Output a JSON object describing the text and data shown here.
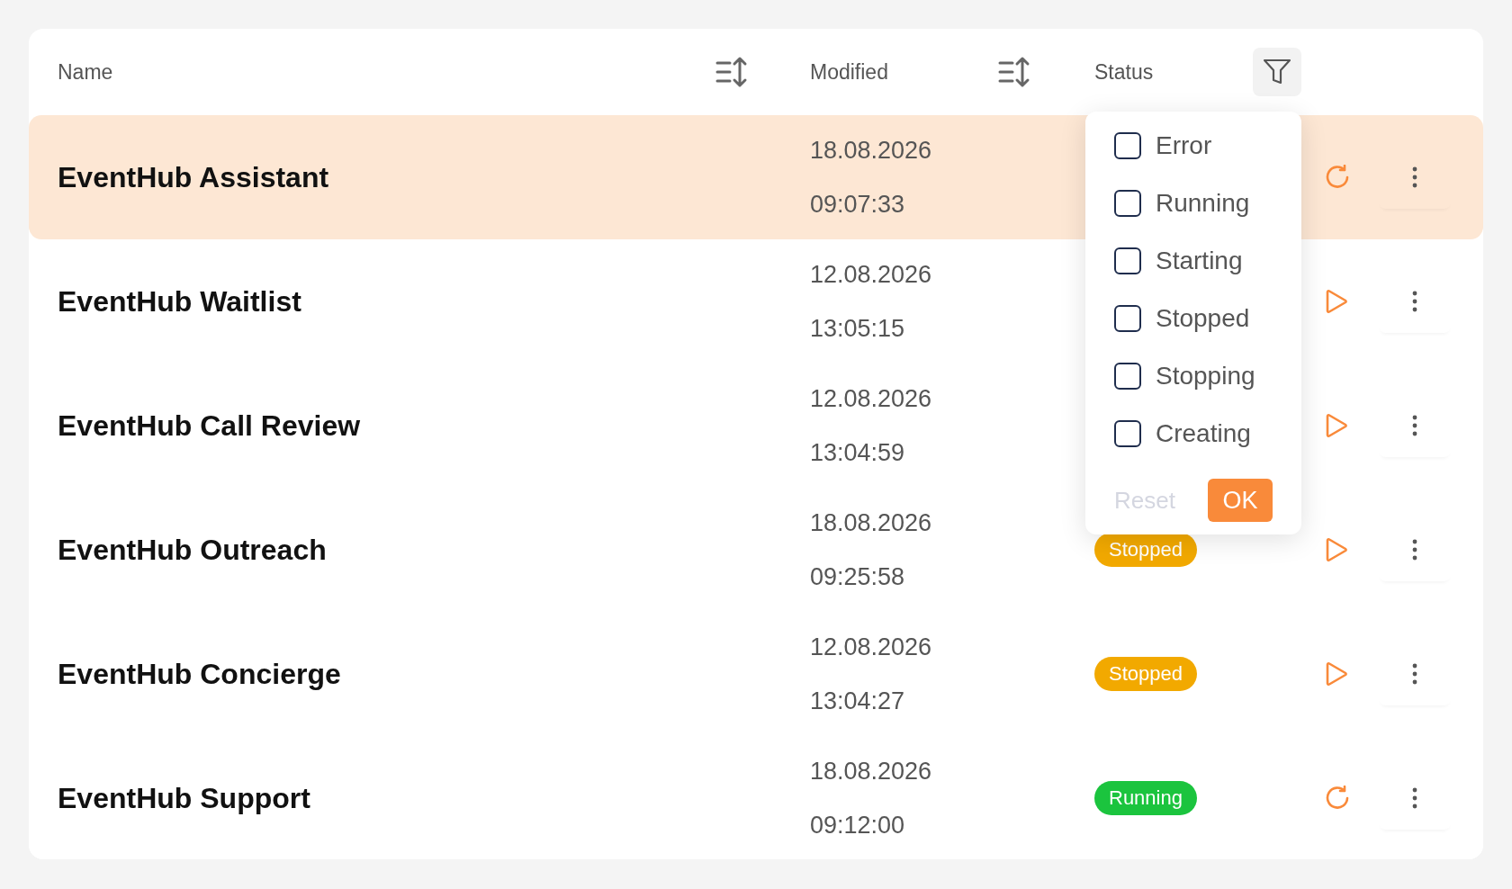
{
  "table": {
    "columns": [
      {
        "label": "Name",
        "sortable": true
      },
      {
        "label": "Modified",
        "sortable": true
      },
      {
        "label": "Status",
        "filterable": true
      }
    ],
    "rows": [
      {
        "name": "EventHub Assistant",
        "date": "18.08.2026",
        "time": "09:07:33",
        "selected": true,
        "kind": "restart"
      },
      {
        "name": "EventHub Waitlist",
        "date": "12.08.2026",
        "time": "13:05:15",
        "selected": false,
        "kind": "play"
      },
      {
        "name": "EventHub Call Review",
        "date": "12.08.2026",
        "time": "13:04:59",
        "selected": false,
        "kind": "play"
      },
      {
        "name": "EventHub Outreach",
        "date": "18.08.2026",
        "time": "09:25:58",
        "selected": false,
        "kind": "play",
        "status": {
          "label": "Stopped",
          "color": "#f2a900"
        }
      },
      {
        "name": "EventHub Concierge",
        "date": "12.08.2026",
        "time": "13:04:27",
        "selected": false,
        "kind": "play",
        "status": {
          "label": "Stopped",
          "color": "#f2a900"
        }
      },
      {
        "name": "EventHub Support",
        "date": "18.08.2026",
        "time": "09:12:00",
        "selected": false,
        "kind": "restart",
        "status": {
          "label": "Running",
          "color": "#1bc43e"
        }
      }
    ]
  },
  "filter_popup": {
    "options": [
      {
        "label": "Error",
        "checked": false
      },
      {
        "label": "Running",
        "checked": false
      },
      {
        "label": "Starting",
        "checked": false
      },
      {
        "label": "Stopped",
        "checked": false
      },
      {
        "label": "Stopping",
        "checked": false
      },
      {
        "label": "Creating",
        "checked": false
      }
    ],
    "reset": "Reset",
    "ok": "OK"
  }
}
